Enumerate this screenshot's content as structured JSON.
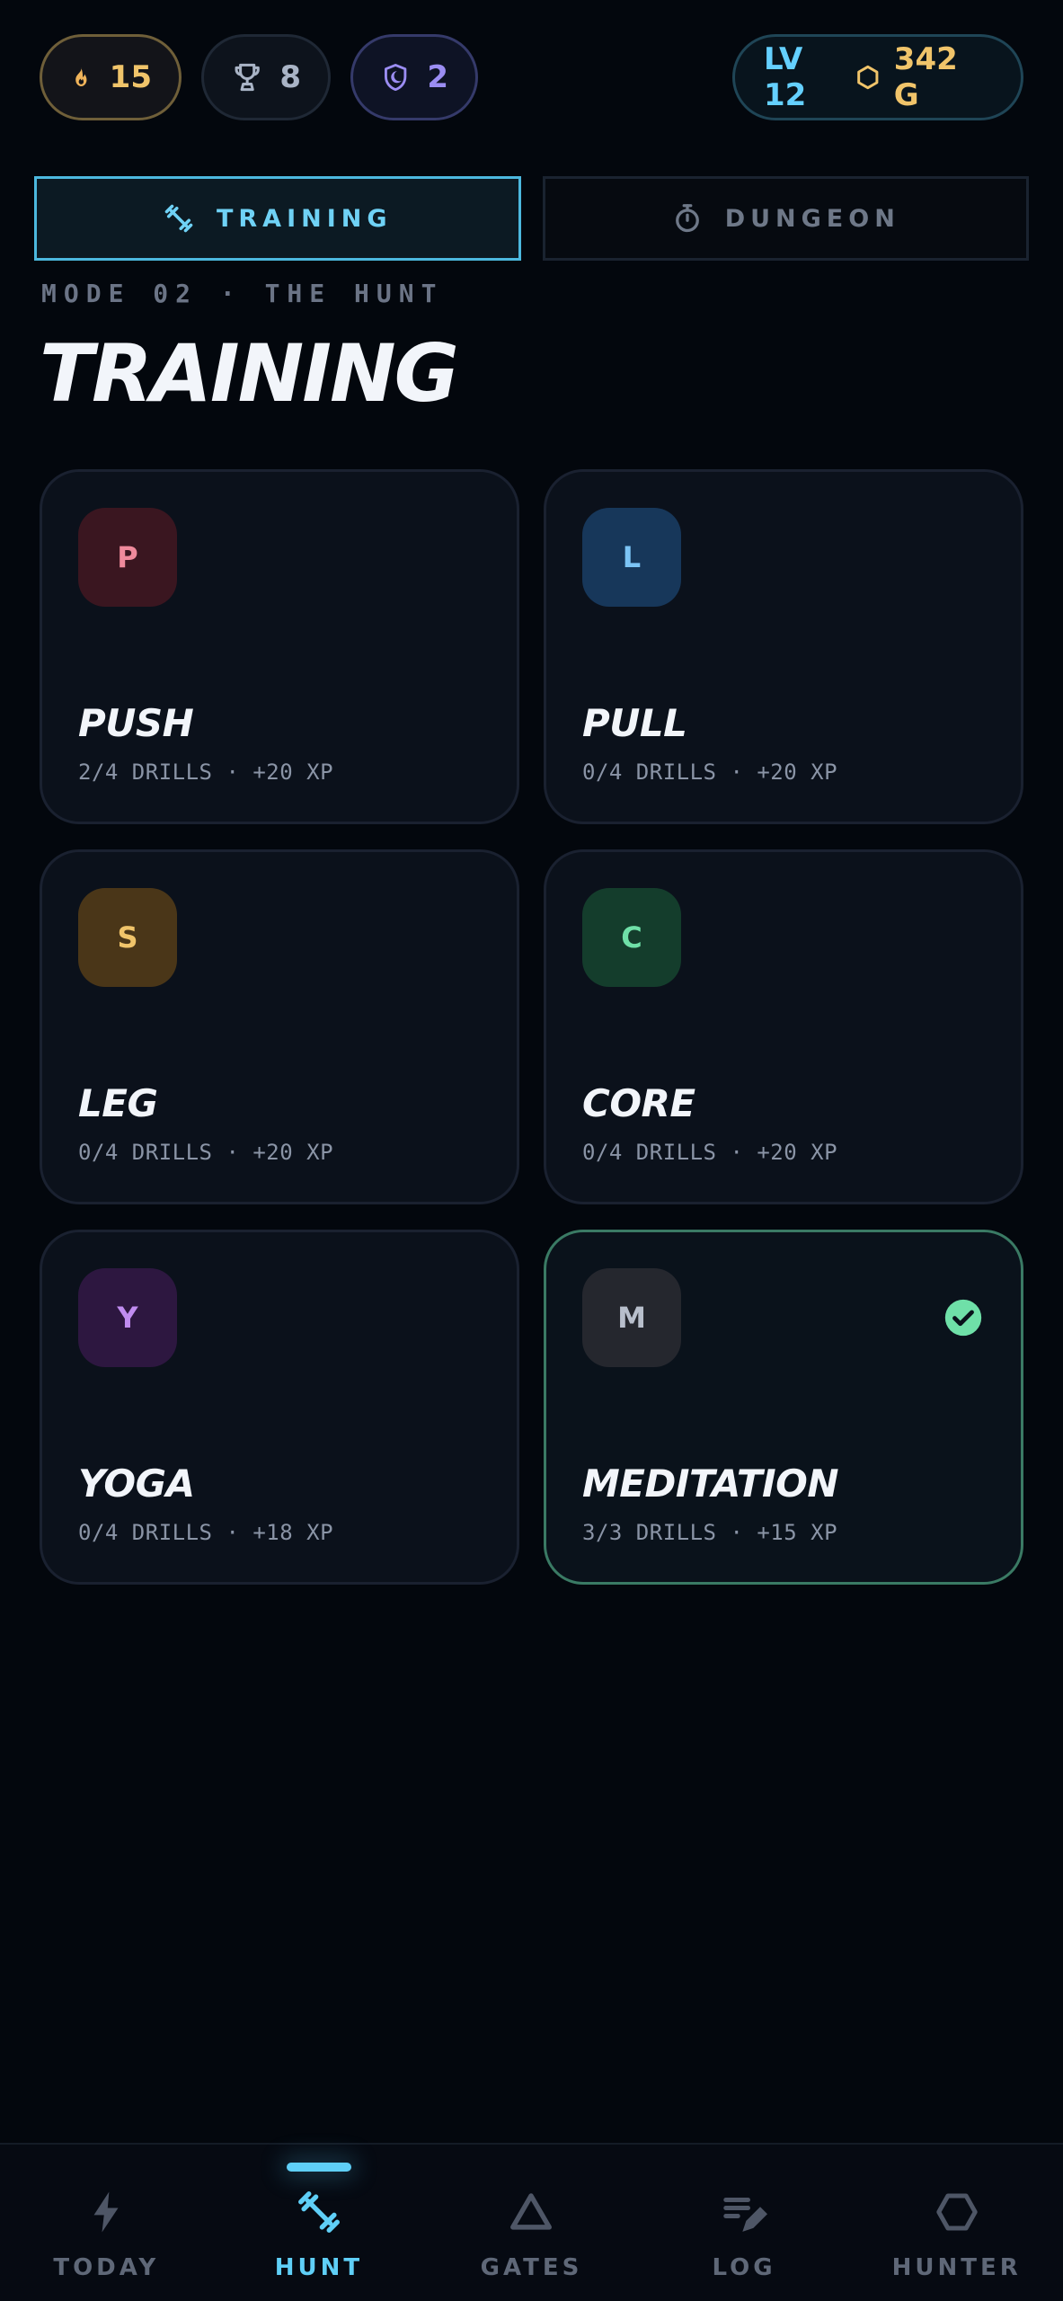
{
  "stats": {
    "streak": "15",
    "trophies": "8",
    "shields": "2",
    "level": "LV 12",
    "gold": "342 G"
  },
  "mode_tabs": [
    {
      "label": "TRAINING",
      "active": true,
      "icon": "dumbbell-icon"
    },
    {
      "label": "DUNGEON",
      "active": false,
      "icon": "stopwatch-icon"
    }
  ],
  "mode_label": "MODE 02 · THE HUNT",
  "page_title": "TRAINING",
  "cards": [
    {
      "letter": "P",
      "title": "PUSH",
      "meta": "2/4 DRILLS · +20 XP",
      "badge_bg": "#3a1620",
      "badge_fg": "#ef8a9c",
      "completed": false
    },
    {
      "letter": "L",
      "title": "PULL",
      "meta": "0/4 DRILLS · +20 XP",
      "badge_bg": "#17375a",
      "badge_fg": "#7cc4f5",
      "completed": false
    },
    {
      "letter": "S",
      "title": "LEG",
      "meta": "0/4 DRILLS · +20 XP",
      "badge_bg": "#4a3618",
      "badge_fg": "#f0c46a",
      "completed": false
    },
    {
      "letter": "C",
      "title": "CORE",
      "meta": "0/4 DRILLS · +20 XP",
      "badge_bg": "#143d2c",
      "badge_fg": "#6fe0a8",
      "completed": false
    },
    {
      "letter": "Y",
      "title": "YOGA",
      "meta": "0/4 DRILLS · +18 XP",
      "badge_bg": "#2d1740",
      "badge_fg": "#c08cf0",
      "completed": false
    },
    {
      "letter": "M",
      "title": "MEDITATION",
      "meta": "3/3 DRILLS · +15 XP",
      "badge_bg": "#25272e",
      "badge_fg": "#b8bfcc",
      "completed": true
    }
  ],
  "nav": [
    {
      "label": "TODAY",
      "icon": "bolt-icon",
      "active": false
    },
    {
      "label": "HUNT",
      "icon": "dumbbell-icon",
      "active": true
    },
    {
      "label": "GATES",
      "icon": "triangle-icon",
      "active": false
    },
    {
      "label": "LOG",
      "icon": "edit-list-icon",
      "active": false
    },
    {
      "label": "HUNTER",
      "icon": "hexagon-icon",
      "active": false
    }
  ],
  "colors": {
    "accent": "#5fcff7",
    "gold": "#f0c46a",
    "success": "#6fe0a8",
    "background": "#03070d"
  }
}
